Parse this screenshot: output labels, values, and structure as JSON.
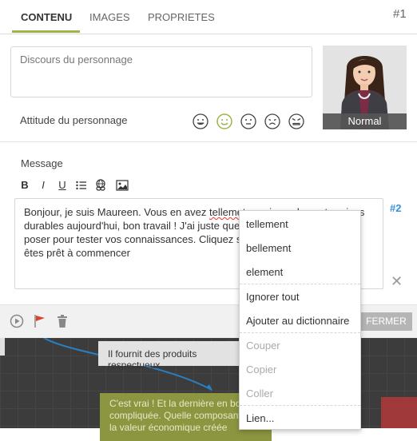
{
  "tabs": [
    {
      "label": "CONTENU",
      "active": true
    },
    {
      "label": "IMAGES",
      "active": false
    },
    {
      "label": "PROPRIETES",
      "active": false
    }
  ],
  "badge_primary": "#1",
  "badge_secondary": "#2",
  "discours_placeholder": "Discours du personnage",
  "portrait_caption": "Normal",
  "attitude_label": "Attitude du personnage",
  "attitudes": [
    "happy-face-icon",
    "smile-face-icon-selected",
    "neutral-face-icon",
    "sad-face-icon",
    "angry-face-icon"
  ],
  "message_label": "Message",
  "format_toolbar": {
    "bold": "B",
    "italic": "I",
    "underline": "U",
    "list_icon": "list-icon",
    "link_icon": "link-icon",
    "image_icon": "image-icon"
  },
  "message": {
    "before_spell": "Bonjour, je suis Maureen. Vous en avez ",
    "spell_word": "tellemet",
    "after_spell": " appris sur les entreprises durables aujourd'hui, bon travail ! J'ai juste quelques questions à vous poser pour tester vos connaissances. Cliquez sur le bouton quand vous êtes prêt à commencer"
  },
  "fermer_label": "FERMER",
  "bottom_toolbar_icons": [
    "play-icon",
    "flag-icon",
    "trash-icon"
  ],
  "background_cards": {
    "card1": "Il fournit des produits respectueux",
    "card2": "C'est vrai ! Et la dernière en bonne compliquée. Quelle composante de la valeur économique créée"
  },
  "context_menu": {
    "suggestions": [
      "tellement",
      "bellement",
      "element"
    ],
    "spell_actions": [
      "Ignorer tout",
      "Ajouter au dictionnaire"
    ],
    "edit_actions": [
      "Couper",
      "Copier",
      "Coller"
    ],
    "link_action": "Lien..."
  },
  "colors": {
    "accent_green": "#9db44a",
    "badge_blue": "#3a8fd8",
    "flag_red": "#d9452b"
  }
}
